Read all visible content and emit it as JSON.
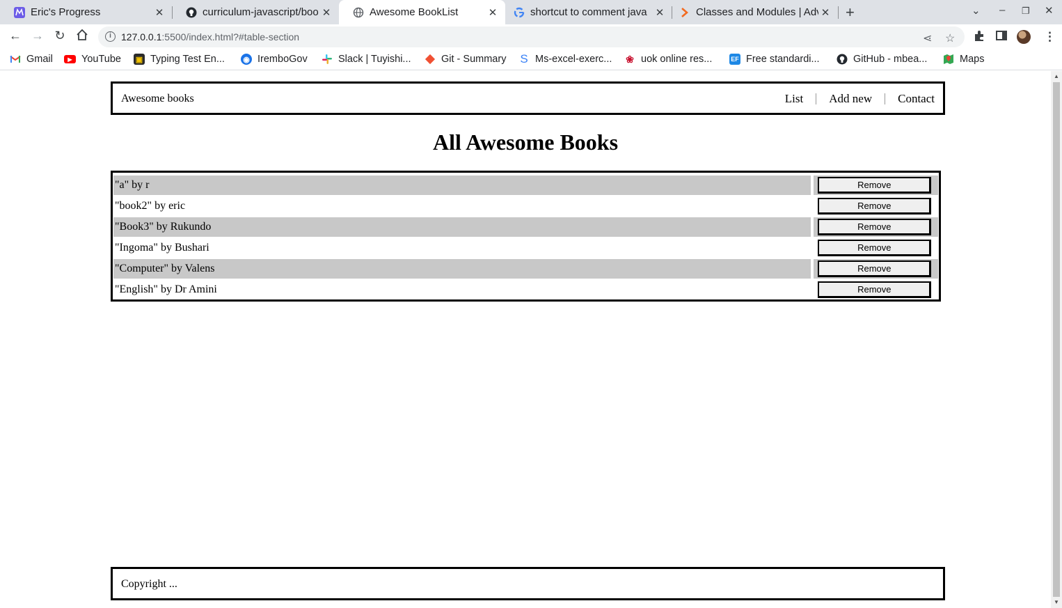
{
  "browser": {
    "tabs": [
      {
        "title": "Eric's Progress",
        "favicon": "microverse-icon",
        "active": false
      },
      {
        "title": "curriculum-javascript/boo",
        "favicon": "github-icon",
        "active": false
      },
      {
        "title": "Awesome BookList",
        "favicon": "globe-icon",
        "active": true
      },
      {
        "title": "shortcut to comment java",
        "favicon": "google-icon",
        "active": false
      },
      {
        "title": "Classes and Modules | Adv",
        "favicon": "arrow-icon",
        "active": false
      }
    ],
    "url_host": "127.0.0.1",
    "url_rest": ":5500/index.html?#table-section",
    "bookmarks": [
      {
        "label": "Gmail",
        "icon": "gmail-icon",
        "color": "#ea4335"
      },
      {
        "label": "YouTube",
        "icon": "youtube-icon",
        "color": "#ff0000"
      },
      {
        "label": "Typing Test En...",
        "icon": "typing-icon",
        "color": "#2b2b2b"
      },
      {
        "label": "IremboGov",
        "icon": "irembo-icon",
        "color": "#1a73e8"
      },
      {
        "label": "Slack | Tuyishi...",
        "icon": "slack-icon",
        "color": "#e01e5a"
      },
      {
        "label": "Git - Summary",
        "icon": "git-icon",
        "color": "#f05033"
      },
      {
        "label": "Ms-excel-exerc...",
        "icon": "s-icon",
        "color": "#3b82f6"
      },
      {
        "label": "uok online res...",
        "icon": "huawei-icon",
        "color": "#c8102e"
      },
      {
        "label": "Free standardi...",
        "icon": "ef-icon",
        "color": "#1e88e5"
      },
      {
        "label": "GitHub - mbea...",
        "icon": "github-icon",
        "color": "#24292f"
      },
      {
        "label": "Maps",
        "icon": "maps-icon",
        "color": "#34a853"
      }
    ]
  },
  "site": {
    "brand": "Awesome books",
    "nav": [
      "List",
      "Add new",
      "Contact"
    ],
    "page_title": "All Awesome Books",
    "books": [
      {
        "text": "\"a\" by r",
        "shaded": true
      },
      {
        "text": "\"book2\" by eric",
        "shaded": false
      },
      {
        "text": "\"Book3\" by Rukundo",
        "shaded": true
      },
      {
        "text": "\"Ingoma\" by Bushari",
        "shaded": false
      },
      {
        "text": "\"Computer\" by Valens",
        "shaded": true
      },
      {
        "text": "\"English\" by Dr Amini",
        "shaded": false
      }
    ],
    "remove_label": "Remove",
    "footer": "Copyright ..."
  }
}
